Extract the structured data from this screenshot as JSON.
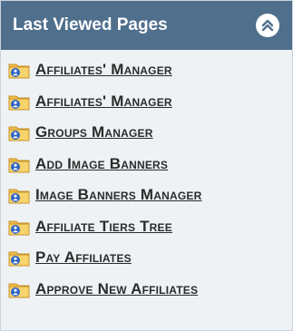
{
  "panel": {
    "title": "Last Viewed Pages"
  },
  "items": [
    {
      "label": "Affiliates' Manager"
    },
    {
      "label": "Affiliates' Manager"
    },
    {
      "label": "Groups Manager"
    },
    {
      "label": "Add Image Banners"
    },
    {
      "label": "Image Banners Manager"
    },
    {
      "label": "Affiliate Tiers Tree"
    },
    {
      "label": "Pay Affiliates"
    },
    {
      "label": "Approve New Affiliates"
    }
  ],
  "icons": {
    "collapse": "chevrons-up-icon",
    "item": "folder-user-icon"
  },
  "colors": {
    "header_bg": "#4f6f8d",
    "panel_bg": "#eef2f5",
    "folder": "#f2c14e",
    "badge": "#2c63c9"
  }
}
